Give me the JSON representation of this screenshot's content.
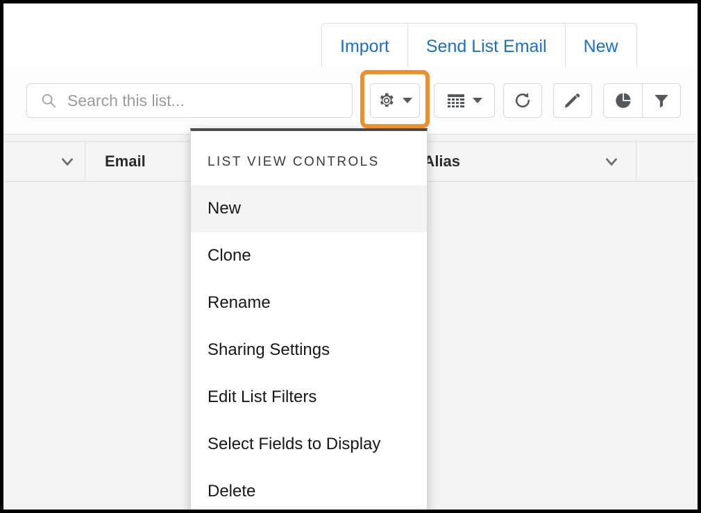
{
  "header_actions": [
    {
      "label": "Import",
      "name": "import-button"
    },
    {
      "label": "Send List Email",
      "name": "send-list-email-button"
    },
    {
      "label": "New",
      "name": "new-button"
    }
  ],
  "search": {
    "placeholder": "Search this list...",
    "value": "",
    "icon": "search-icon"
  },
  "toolbar_icons": [
    {
      "name": "list-view-controls-gear-icon",
      "glyph": "gear",
      "has_caret": true,
      "highlighted": true
    },
    {
      "name": "display-as-table-icon",
      "glyph": "table",
      "has_caret": true,
      "highlighted": false
    },
    {
      "name": "refresh-icon",
      "glyph": "refresh",
      "has_caret": false,
      "highlighted": false
    },
    {
      "name": "edit-pencil-icon",
      "glyph": "pencil",
      "has_caret": false,
      "highlighted": false
    },
    {
      "name": "charts-pie-icon",
      "glyph": "pie",
      "has_caret": false,
      "highlighted": false
    },
    {
      "name": "filter-funnel-icon",
      "glyph": "funnel",
      "has_caret": false,
      "highlighted": false
    }
  ],
  "highlight": {
    "color": "#e8912d",
    "target": "list-view-controls-gear-icon"
  },
  "table": {
    "columns": [
      {
        "label": "",
        "has_chevron": true
      },
      {
        "label": "Email",
        "has_chevron": false
      },
      {
        "label": "ct Owner Alias",
        "has_chevron": true
      },
      {
        "label": "",
        "has_chevron": false
      }
    ]
  },
  "dropdown": {
    "heading": "LIST VIEW CONTROLS",
    "items": [
      {
        "label": "New",
        "selected": true
      },
      {
        "label": "Clone",
        "selected": false
      },
      {
        "label": "Rename",
        "selected": false
      },
      {
        "label": "Sharing Settings",
        "selected": false
      },
      {
        "label": "Edit List Filters",
        "selected": false
      },
      {
        "label": "Select Fields to Display",
        "selected": false
      },
      {
        "label": "Delete",
        "selected": false
      }
    ]
  },
  "colors": {
    "link_blue": "#1b6fc4",
    "highlight_orange": "#e8912d",
    "icon_gray": "#53585d",
    "page_bg": "#f3f3f3"
  }
}
